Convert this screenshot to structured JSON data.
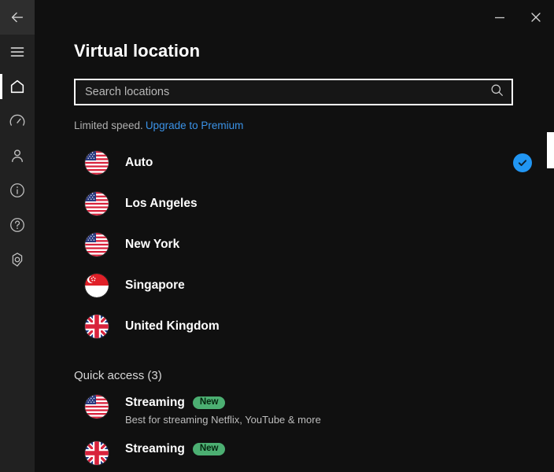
{
  "window": {
    "minimize_label": "Minimize",
    "close_label": "Close",
    "minimize_icon": "minimize-icon",
    "close_icon": "close-icon"
  },
  "sidebar": {
    "items": [
      {
        "name": "back",
        "label": "Back",
        "icon": "arrow-left-icon",
        "active": false
      },
      {
        "name": "menu",
        "label": "Menu",
        "icon": "hamburger-menu-icon",
        "active": false
      },
      {
        "name": "home",
        "label": "Home",
        "icon": "home-icon",
        "active": true
      },
      {
        "name": "speed",
        "label": "Speed test",
        "icon": "speedometer-icon",
        "active": false
      },
      {
        "name": "account",
        "label": "Account",
        "icon": "person-icon",
        "active": false
      },
      {
        "name": "info",
        "label": "Info",
        "icon": "info-circle-icon",
        "active": false
      },
      {
        "name": "help",
        "label": "Help",
        "icon": "question-circle-icon",
        "active": false
      },
      {
        "name": "settings",
        "label": "Settings",
        "icon": "gear-icon",
        "active": false
      }
    ]
  },
  "header": {
    "title": "Virtual location"
  },
  "search": {
    "placeholder": "Search locations",
    "value": "",
    "icon": "search-icon"
  },
  "notice": {
    "text": "Limited speed.",
    "link_text": "Upgrade to Premium",
    "link_color": "#3b93e8"
  },
  "locations": [
    {
      "label": "Auto",
      "flag": "us",
      "selected": true
    },
    {
      "label": "Los Angeles",
      "flag": "us",
      "selected": false
    },
    {
      "label": "New York",
      "flag": "us",
      "selected": false
    },
    {
      "label": "Singapore",
      "flag": "sg",
      "selected": false
    },
    {
      "label": "United Kingdom",
      "flag": "gb",
      "selected": false
    }
  ],
  "quick_access": {
    "heading": "Quick access (3)",
    "items": [
      {
        "title": "Streaming",
        "badge": "New",
        "subtitle": "Best for streaming Netflix, YouTube & more",
        "flag": "us"
      },
      {
        "title": "Streaming",
        "badge": "New",
        "subtitle": "",
        "flag": "gb"
      }
    ]
  },
  "colors": {
    "accent_blue": "#2196f3",
    "badge_green": "#4caf72",
    "sidebar_bg": "#212121",
    "content_bg": "#101010"
  },
  "scrollbar": {
    "name": "vertical-scrollbar"
  }
}
